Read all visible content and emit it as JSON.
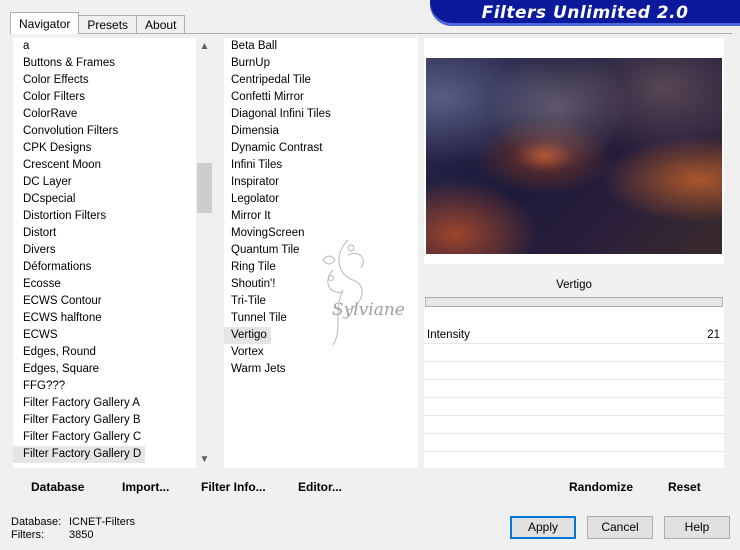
{
  "tabs": [
    "Navigator",
    "Presets",
    "About"
  ],
  "banner": {
    "title": "Filters Unlimited 2.0"
  },
  "categories": [
    "a",
    "Buttons & Frames",
    "Color Effects",
    "Color Filters",
    "ColorRave",
    "Convolution Filters",
    "CPK Designs",
    "Crescent Moon",
    "DC Layer",
    "DCspecial",
    "Distortion Filters",
    "Distort",
    "Divers",
    "Déformations",
    "Ecosse",
    "ECWS Contour",
    "ECWS halftone",
    "ECWS",
    "Edges, Round",
    "Edges, Square",
    "FFG???",
    "Filter Factory Gallery A",
    "Filter Factory Gallery B",
    "Filter Factory Gallery C",
    "Filter Factory Gallery D"
  ],
  "selected_category": "Filter Factory Gallery D",
  "filters": [
    "Beta Ball",
    "BurnUp",
    "Centripedal Tile",
    "Confetti Mirror",
    "Diagonal Infini Tiles",
    "Dimensia",
    "Dynamic Contrast",
    "Infini Tiles",
    "Inspirator",
    "Legolator",
    "Mirror It",
    "MovingScreen",
    "Quantum Tile",
    "Ring Tile",
    "Shoutin'!",
    "Tri-Tile",
    "Tunnel Tile",
    "Vertigo",
    "Vortex",
    "Warm Jets"
  ],
  "selected_filter": "Vertigo",
  "controls": {
    "filter_name": "Vertigo",
    "params": [
      {
        "label": "Intensity",
        "value": "21"
      }
    ]
  },
  "bottom_left_buttons": [
    "Database",
    "Import...",
    "Filter Info...",
    "Editor..."
  ],
  "bottom_right_buttons": [
    "Randomize",
    "Reset"
  ],
  "status": {
    "database_label": "Database:",
    "database_value": "ICNET-Filters",
    "filters_label": "Filters:",
    "filters_value": "3850"
  },
  "dialog_buttons": {
    "apply": "Apply",
    "cancel": "Cancel",
    "help": "Help"
  },
  "scrollbar_icons": {
    "up": "chevron-up-icon",
    "down": "chevron-down-icon"
  },
  "watermark_text": "Sylviane",
  "colors": {
    "banner": "#0b1a9c",
    "default_button_border": "#0078d7"
  }
}
